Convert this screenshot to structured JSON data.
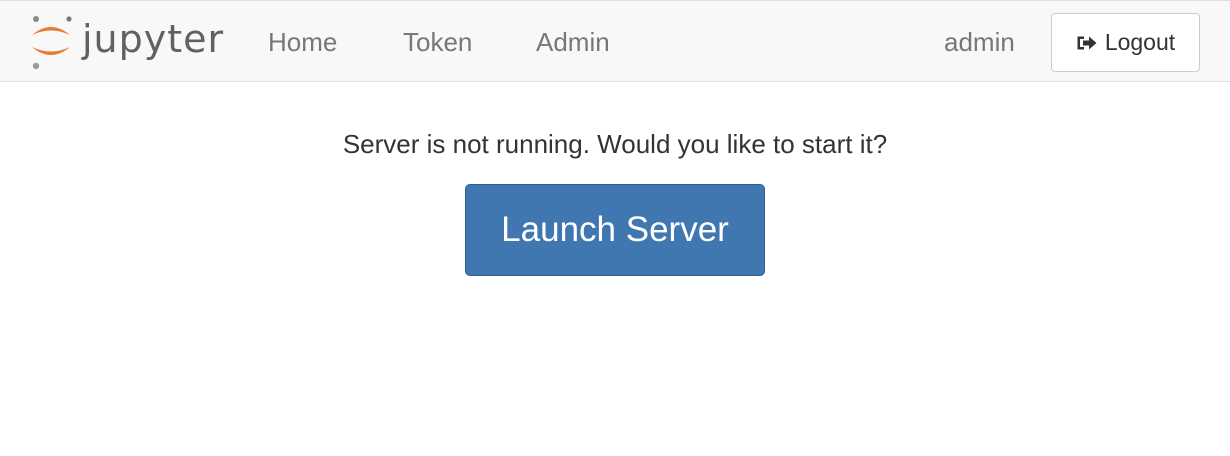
{
  "navbar": {
    "brand_text": "jupyter",
    "links": {
      "home": "Home",
      "token": "Token",
      "admin": "Admin"
    },
    "user": "admin",
    "logout_label": "Logout"
  },
  "main": {
    "message": "Server is not running. Would you like to start it?",
    "launch_label": "Launch Server"
  },
  "colors": {
    "navbar_bg": "#f8f8f8",
    "brand_orange": "#e77b35",
    "brand_gray": "#616161",
    "primary_button": "#4177b1",
    "link_gray": "#777777"
  },
  "icons": {
    "brand": "jupyter-logo-icon",
    "logout": "sign-out-icon"
  }
}
